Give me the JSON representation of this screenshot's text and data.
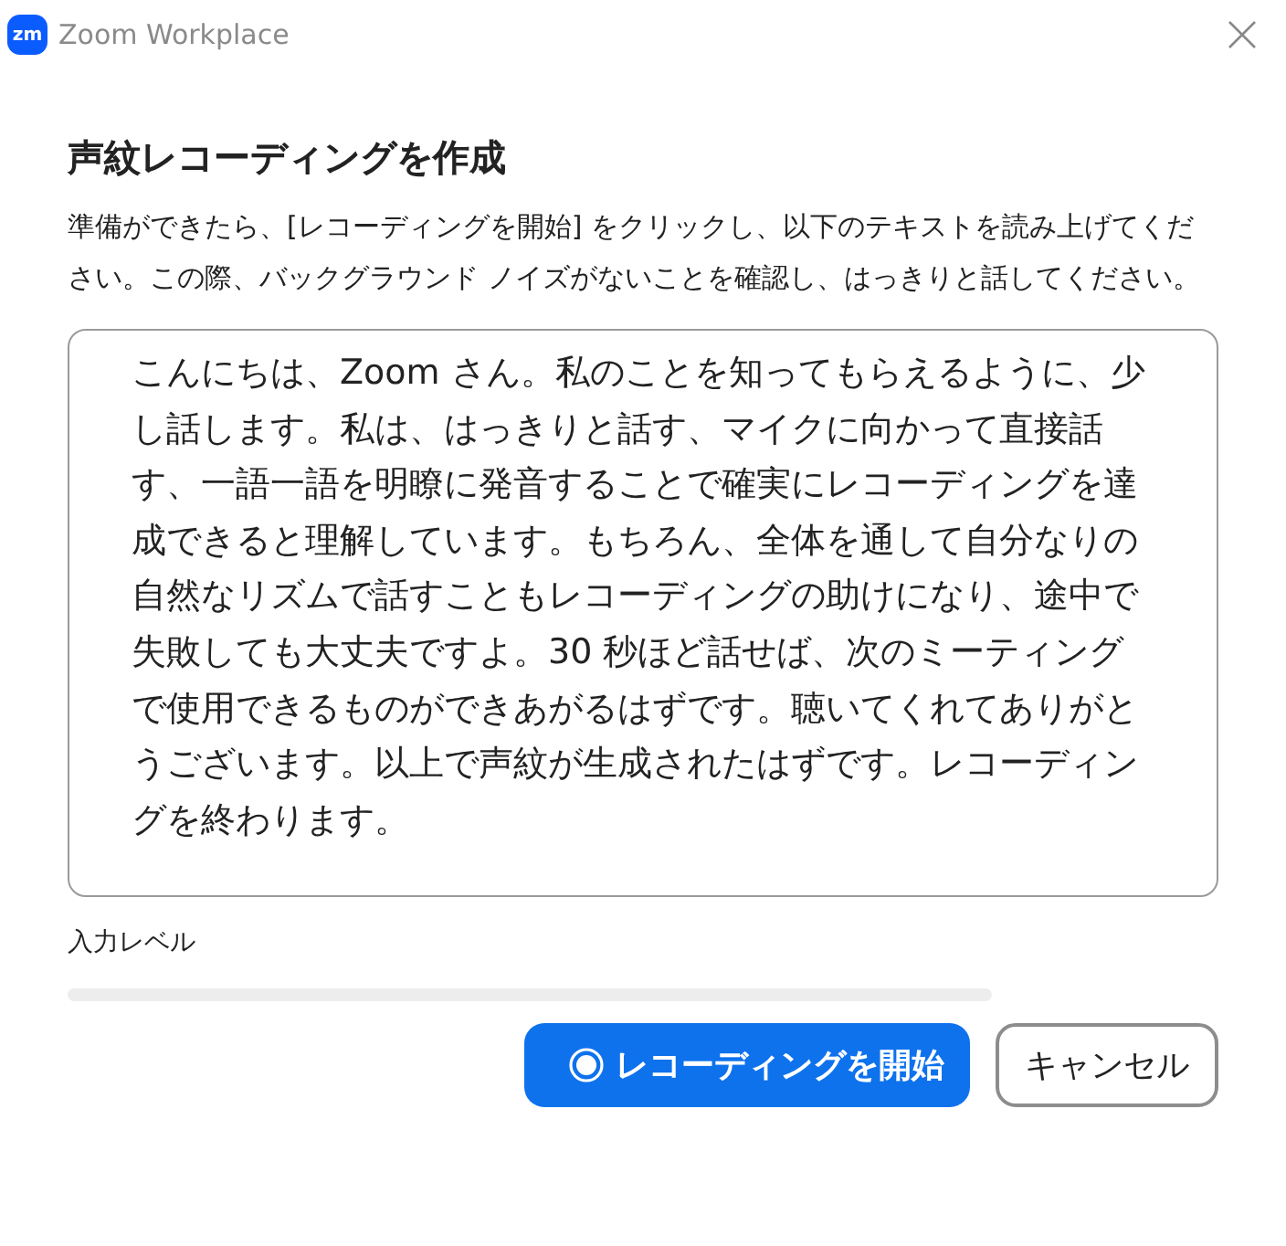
{
  "window": {
    "title": "Zoom Workplace",
    "logo": "zm"
  },
  "heading": "声紋レコーディングを作成",
  "instructions": "準備ができたら、[レコーディングを開始] をクリックし、以下のテキストを読み上げてください。この際、バックグラウンド ノイズがないことを確認し、はっきりと話してください。",
  "script_text": "こんにちは、Zoom さん。私のことを知ってもらえるように、少し話します。私は、はっきりと話す、マイクに向かって直接話す、一語一語を明瞭に発音することで確実にレコーディングを達成できると理解しています。もちろん、全体を通して自分なりの自然なリズムで話すこともレコーディングの助けになり、途中で失敗しても大丈夫ですよ。30 秒ほど話せば、次のミーティングで使用できるものができあがるはずです。聴いてくれてありがとうございます。以上で声紋が生成されたはずです。レコーディングを終わります。",
  "input_level": {
    "label": "入力レベル"
  },
  "buttons": [
    {
      "label": "レコーディングを開始",
      "kind": "primary"
    },
    {
      "label": "キャンセル",
      "kind": "secondary"
    }
  ]
}
